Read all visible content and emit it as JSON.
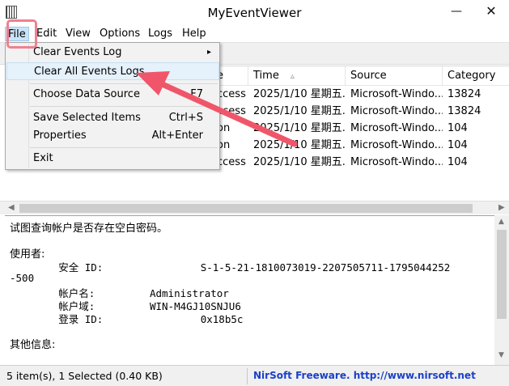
{
  "window": {
    "title": "MyEventViewer",
    "minimize_glyph": "—",
    "close_glyph": "✕"
  },
  "menubar": {
    "items": [
      "File",
      "Edit",
      "View",
      "Options",
      "Logs",
      "Help"
    ]
  },
  "file_menu": {
    "items": [
      {
        "label": "Clear Events Log",
        "shortcut": "",
        "submenu_glyph": "▸"
      },
      {
        "label": "Clear All Events Logs",
        "shortcut": ""
      },
      {
        "label": "Choose Data Source",
        "shortcut": "F7"
      },
      {
        "label": "Save Selected Items",
        "shortcut": "Ctrl+S"
      },
      {
        "label": "Properties",
        "shortcut": "Alt+Enter"
      },
      {
        "label": "Exit",
        "shortcut": ""
      }
    ]
  },
  "listview": {
    "columns": [
      "e",
      "Time",
      "Source",
      "Category"
    ],
    "rows": [
      [
        "ccess",
        "2025/1/10 星期五...",
        "Microsoft-Windo...",
        "13824"
      ],
      [
        "ccess",
        "2025/1/10 星期五...",
        "Microsoft-Windo...",
        "13824"
      ],
      [
        "on",
        "2025/1/10 星期五...",
        "Microsoft-Windo...",
        "104"
      ],
      [
        "on",
        "2025/1/10 星期五...",
        "Microsoft-Windo...",
        "104"
      ],
      [
        "ccess",
        "2025/1/10 星期五...",
        "Microsoft-Windo...",
        "104"
      ]
    ]
  },
  "detail": {
    "lines": [
      "试图查询帐户是否存在空白密码。",
      "",
      "使用者:",
      "        安全 ID:                S-1-5-21-1810073019-2207505711-1795044252",
      "-500",
      "        帐户名:         Administrator",
      "        帐户域:         WIN-M4GJ10SNJU6",
      "        登录 ID:                0x18b5c",
      "",
      "其他信息:"
    ]
  },
  "statusbar": {
    "items_text": "5 item(s), 1 Selected  (0.40 KB)",
    "link_text": "NirSoft Freeware.  http://www.nirsoft.net"
  },
  "colors": {
    "annotation": "#f0566a",
    "link": "#1b40c8",
    "menu_highlight": "#cce4f7"
  }
}
